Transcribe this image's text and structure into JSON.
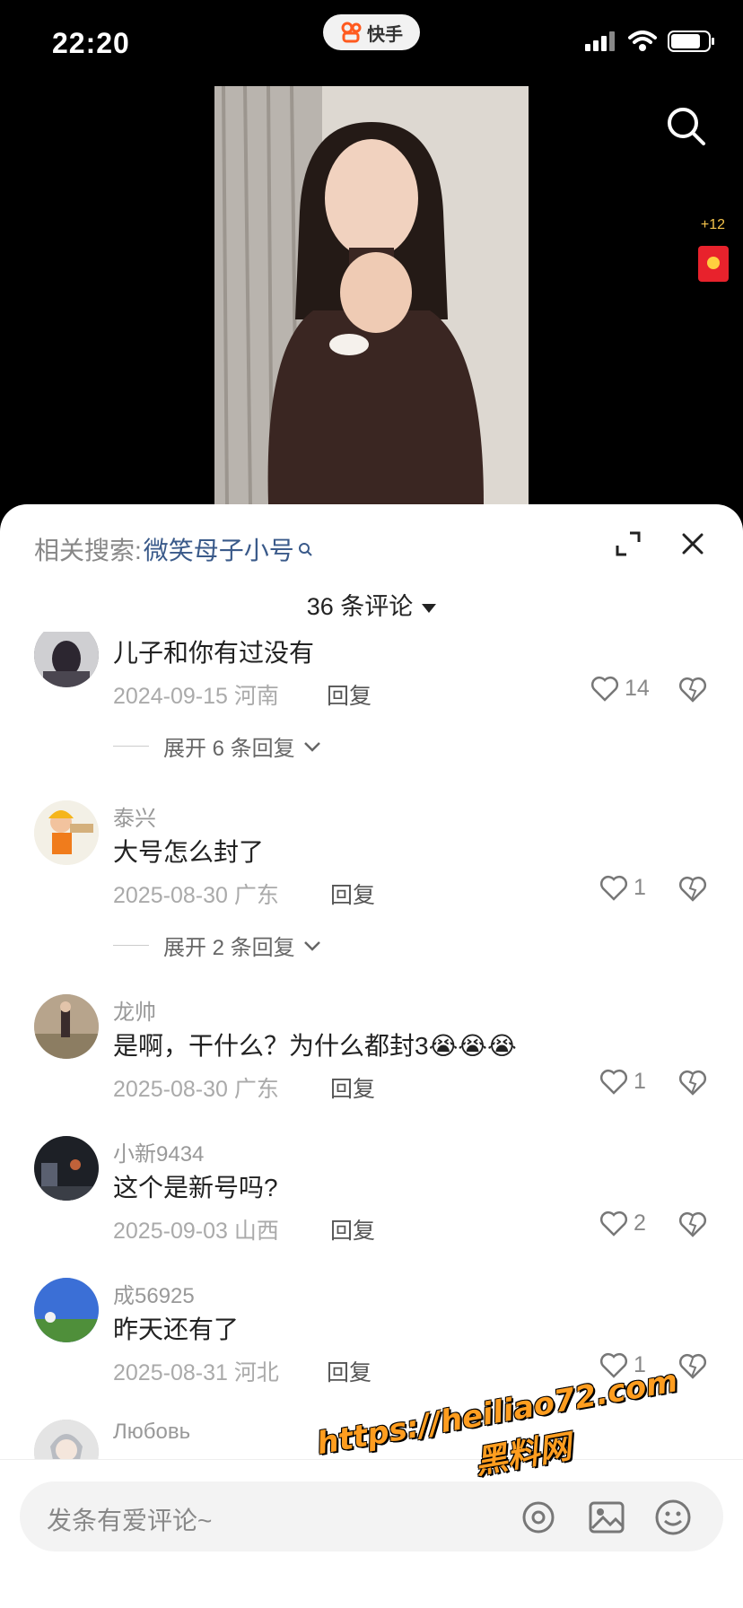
{
  "status_bar": {
    "time": "22:20",
    "app_name": "快手"
  },
  "video": {
    "reward_count": "+12"
  },
  "sheet": {
    "related_prefix": "相关搜索:",
    "related_query": "微笑母子小号",
    "comment_count_label": "36 条评论"
  },
  "comments": [
    {
      "username": "",
      "content": "儿子和你有过没有",
      "date": "2024-09-15",
      "location": "河南",
      "reply_label": "回复",
      "likes": "14",
      "expand_label": "展开 6 条回复"
    },
    {
      "username": "泰兴",
      "content": "大号怎么封了",
      "date": "2025-08-30",
      "location": "广东",
      "reply_label": "回复",
      "likes": "1",
      "expand_label": "展开 2 条回复"
    },
    {
      "username": "龙帅",
      "content": "是啊，干什么？为什么都封3😭😭😭",
      "date": "2025-08-30",
      "location": "广东",
      "reply_label": "回复",
      "likes": "1"
    },
    {
      "username": "小新9434",
      "content": "这个是新号吗?",
      "date": "2025-09-03",
      "location": "山西",
      "reply_label": "回复",
      "likes": "2"
    },
    {
      "username": "成56925",
      "content": "昨天还有了",
      "date": "2025-08-31",
      "location": "河北",
      "reply_label": "回复",
      "likes": "1"
    },
    {
      "username": "Любовь"
    }
  ],
  "input": {
    "placeholder": "发条有爱评论~"
  },
  "watermark": {
    "url": "https://heiliao72.com",
    "brand": "黑料网"
  },
  "colors": {
    "accent_link": "#3a5a8a",
    "reward": "#e8222c",
    "watermark": "#ff9d1f"
  }
}
